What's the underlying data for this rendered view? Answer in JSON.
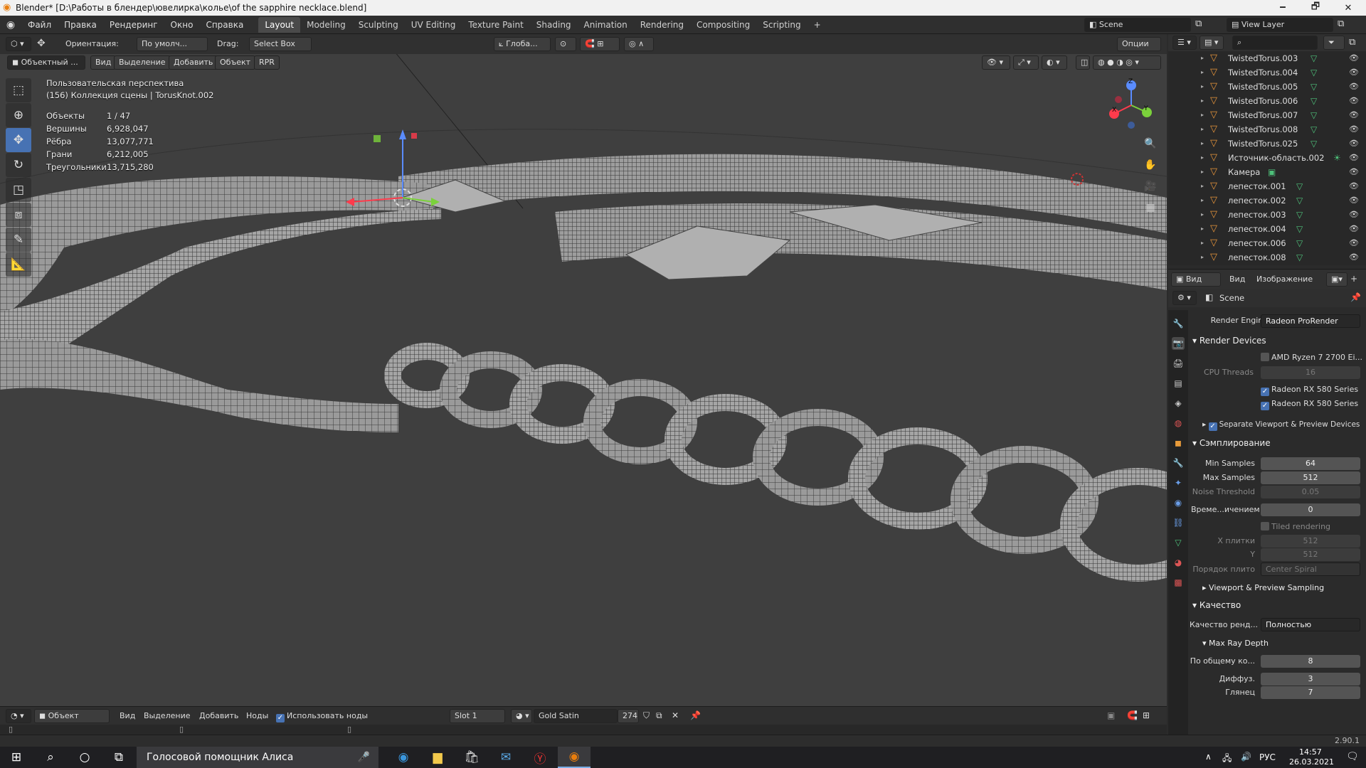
{
  "window": {
    "title": "Blender* [D:\\Работы в блендер\\ювелирка\\колье\\of the sapphire necklace.blend]",
    "minimize": "🗕",
    "maximize": "🗗",
    "close": "✕"
  },
  "menu": [
    "Файл",
    "Правка",
    "Рендеринг",
    "Окно",
    "Справка"
  ],
  "workspaces": [
    "Layout",
    "Modeling",
    "Sculpting",
    "UV Editing",
    "Texture Paint",
    "Shading",
    "Animation",
    "Rendering",
    "Compositing",
    "Scripting",
    "+"
  ],
  "scene": {
    "name": "Scene",
    "view_layer": "View Layer"
  },
  "viewport": {
    "orientation_label": "Ориентация:",
    "orientation_value": "По умолч...",
    "drag_label": "Drag:",
    "drag_value": "Select Box",
    "transform": "Глоба...",
    "options": "Опции",
    "mode": "Объектный ...",
    "menu": [
      "Вид",
      "Выделение",
      "Добавить",
      "Объект",
      "RPR"
    ],
    "view_name": "Пользовательская перспектива",
    "collection": "(156) Коллекция сцены | TorusKnot.002",
    "stats": [
      [
        "Объекты",
        "1 / 47"
      ],
      [
        "Вершины",
        "6,928,047"
      ],
      [
        "Рёбра",
        "13,077,771"
      ],
      [
        "Грани",
        "6,212,005"
      ],
      [
        "Треугольники",
        "13,715,280"
      ]
    ],
    "gizmo": {
      "x": "X",
      "y": "Y",
      "z": "Z"
    }
  },
  "node_header": {
    "mode": "Объект",
    "menu": [
      "Вид",
      "Выделение",
      "Добавить",
      "Ноды"
    ],
    "use_nodes": "Использовать ноды",
    "slot": "Slot 1",
    "material": "Gold Satin",
    "users": "274"
  },
  "outliner": {
    "items": [
      {
        "name": "TwistedTorus.003",
        "kind": "mesh"
      },
      {
        "name": "TwistedTorus.004",
        "kind": "mesh"
      },
      {
        "name": "TwistedTorus.005",
        "kind": "mesh"
      },
      {
        "name": "TwistedTorus.006",
        "kind": "mesh"
      },
      {
        "name": "TwistedTorus.007",
        "kind": "mesh"
      },
      {
        "name": "TwistedTorus.008",
        "kind": "mesh"
      },
      {
        "name": "TwistedTorus.025",
        "kind": "mesh"
      },
      {
        "name": "Источник-область.002",
        "kind": "light"
      },
      {
        "name": "Камера",
        "kind": "camera"
      },
      {
        "name": "лепесток.001",
        "kind": "mesh"
      },
      {
        "name": "лепесток.002",
        "kind": "mesh"
      },
      {
        "name": "лепесток.003",
        "kind": "mesh"
      },
      {
        "name": "лепесток.004",
        "kind": "mesh"
      },
      {
        "name": "лепесток.006",
        "kind": "mesh"
      },
      {
        "name": "лепесток.008",
        "kind": "mesh"
      }
    ]
  },
  "image_editor": {
    "mode": "Вид",
    "menu": [
      "Вид",
      "Изображение"
    ]
  },
  "properties": {
    "scene": "Scene",
    "render_engine_label": "Render Engine",
    "render_engine": "Radeon ProRender",
    "render_devices": "Render Devices",
    "cpu": "AMD Ryzen 7 2700 Ei...",
    "cpu_threads_label": "CPU Threads",
    "cpu_threads": "16",
    "gpu1": "Radeon RX 580 Series",
    "gpu2": "Radeon RX 580 Series",
    "separate": "Separate Viewport & Preview Devices",
    "sampling": "Сэмплирование",
    "min_samples_label": "Min Samples",
    "min_samples": "64",
    "max_samples_label": "Max Samples",
    "max_samples": "512",
    "noise_label": "Noise Threshold",
    "noise": "0.05",
    "time_label": "Време...ичением",
    "time": "0",
    "tiled": "Tiled rendering",
    "tile_x_label": "X плитки",
    "tile_x": "512",
    "tile_y_label": "Y",
    "tile_y": "512",
    "tile_order_label": "Порядок плито",
    "tile_order": "Center Spiral",
    "viewport_sampling": "Viewport & Preview Sampling",
    "quality": "Качество",
    "render_quality_label": "Качество ренд...",
    "render_quality": "Полностью",
    "max_ray_depth": "Max Ray Depth",
    "total_label": "По общему ко...",
    "total": "8",
    "diffuse_label": "Диффуз.",
    "diffuse": "3",
    "glossy_label": "Глянец",
    "glossy": "7"
  },
  "status": {
    "version": "2.90.1"
  },
  "taskbar": {
    "search": "Голосовой помощник Алиса",
    "lang": "РУС",
    "time": "14:57",
    "date": "26.03.2021"
  },
  "colors": {
    "accent": "#4772b3",
    "header": "#303030",
    "viewport": "#3f3f3f"
  }
}
